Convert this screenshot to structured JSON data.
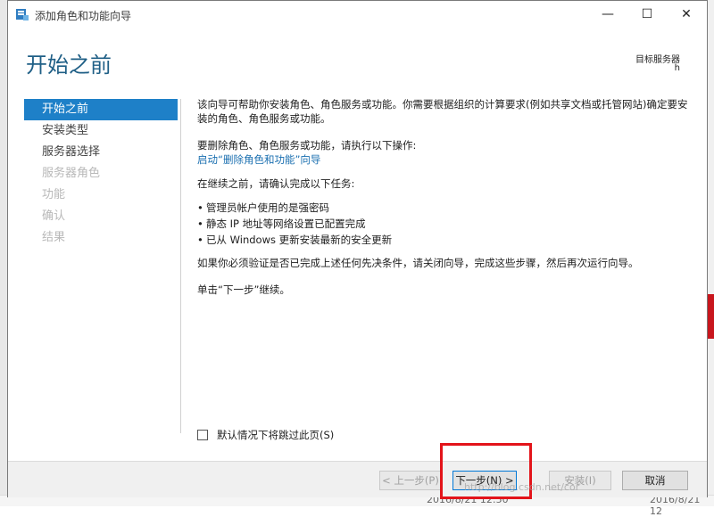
{
  "window": {
    "title": "添加角色和功能向导",
    "controls": {
      "minimize": "—",
      "maximize": "☐",
      "close": "✕"
    }
  },
  "header": {
    "page_title": "开始之前",
    "destination_label": "目标服务器",
    "destination_value": "h"
  },
  "nav": {
    "items": [
      {
        "label": "开始之前",
        "state": "active"
      },
      {
        "label": "安装类型",
        "state": "enabled"
      },
      {
        "label": "服务器选择",
        "state": "enabled"
      },
      {
        "label": "服务器角色",
        "state": "disabled"
      },
      {
        "label": "功能",
        "state": "disabled"
      },
      {
        "label": "确认",
        "state": "disabled"
      },
      {
        "label": "结果",
        "state": "disabled"
      }
    ]
  },
  "content": {
    "intro": "该向导可帮助你安装角色、角色服务或功能。你需要根据组织的计算要求(例如共享文档或托管网站)确定要安装的角色、角色服务或功能。",
    "remove_intro": "要删除角色、角色服务或功能，请执行以下操作:",
    "remove_link": "启动“删除角色和功能”向导",
    "confirm_intro": "在继续之前，请确认完成以下任务:",
    "bullets": [
      "管理员帐户使用的是强密码",
      "静态 IP 地址等网络设置已配置完成",
      "已从 Windows 更新安装最新的安全更新"
    ],
    "verify_text": "如果你必须验证是否已完成上述任何先决条件，请关闭向导，完成这些步骤，然后再次运行向导。",
    "continue_text": "单击“下一步”继续。"
  },
  "skip": {
    "label": "默认情况下将跳过此页(S)",
    "checked": false
  },
  "footer": {
    "prev": "< 上一步(P)",
    "next": "下一步(N) >",
    "install": "安装(I)",
    "cancel": "取消"
  },
  "background": {
    "bottom_left_date": "2016/8/21 12:50",
    "bottom_right_date": "2016/8/21 12",
    "watermark": "http://blog.csdn.net/cor"
  },
  "colors": {
    "accent": "#1e80c8",
    "title": "#1f5f86",
    "link": "#1a6fb0",
    "highlight_box": "#e3141a"
  }
}
